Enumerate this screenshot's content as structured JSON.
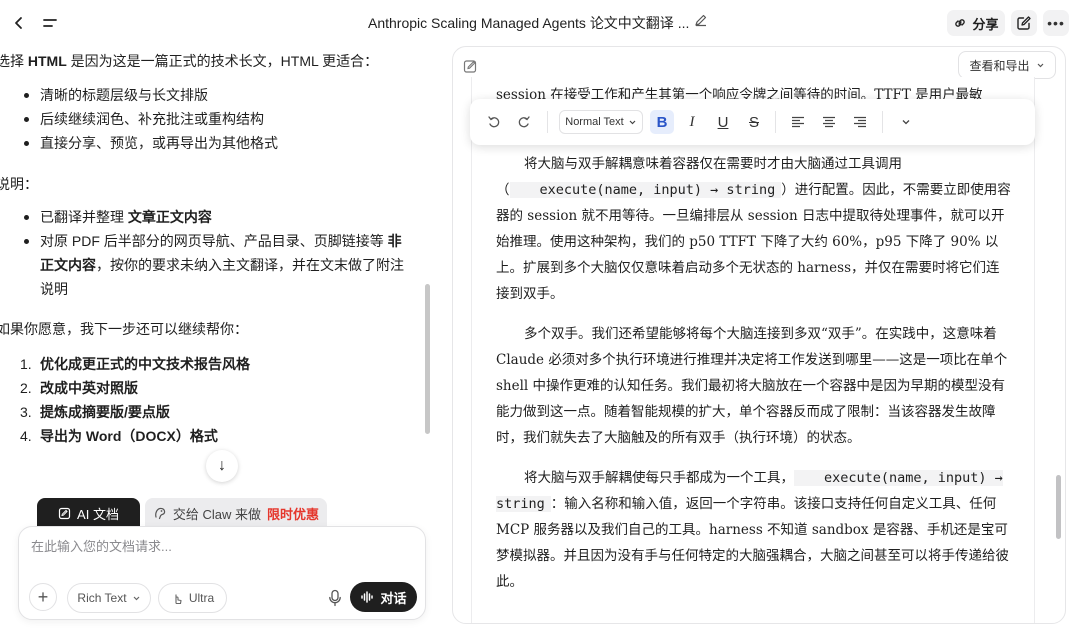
{
  "header": {
    "title": "Anthropic Scaling Managed Agents 论文中文翻译 ...",
    "share_label": "分享",
    "back_icon": "chevron-left-icon",
    "menu_icon": "menu-icon"
  },
  "chat": {
    "intro": [
      "选择 ",
      "HTML",
      " 是因为这是一篇正式的技术长文，HTML 更适合："
    ],
    "reasons": [
      "清晰的标题层级与长文排版",
      "后续继续润色、补充批注或重构结构",
      "直接分享、预览，或再导出为其他格式"
    ],
    "notes_heading": "说明：",
    "notes": [
      {
        "pre": "已翻译并整理 ",
        "bold": "文章正文内容",
        "post": ""
      },
      {
        "pre": "对原 PDF 后半部分的网页导航、产品目录、页脚链接等 ",
        "bold": "非正文内容",
        "post": "，按你的要求未纳入主文翻译，并在文末做了附注说明"
      }
    ],
    "next_heading": "如果你愿意，我下一步还可以继续帮你：",
    "next_steps": [
      "优化成更正式的中文技术报告风格",
      "改成中英对照版",
      "提炼成摘要版/要点版",
      "导出为 Word（DOCX）格式"
    ]
  },
  "composer": {
    "tab_ai": "AI 文档",
    "tab_claw": "交给 Claw 来做",
    "tab_claw_promo": "限时优惠",
    "placeholder": "在此输入您的文档请求...",
    "mode_label": "Rich Text",
    "model_label": "Ultra",
    "talk_label": "对话"
  },
  "document": {
    "export_label": "查看和导出",
    "toolbar": {
      "style_value": "Normal Text"
    },
    "top_line": "session 在接受工作和产生其第一个响应令牌之间等待的时间。TTFT 是用户最敏",
    "p1_pre": "将大脑与双手解耦意味着容器仅在需要时才由大脑通过工具调用（",
    "p1_code": "execute(name, input) → string",
    "p1_post": "）进行配置。因此，不需要立即使用容器的 session 就不用等待。一旦编排层从 session 日志中提取待处理事件，就可以开始推理。使用这种架构，我们的 p50 TTFT 下降了大约 60%，p95 下降了 90% 以上。扩展到多个大脑仅仅意味着启动多个无状态的 harness，并仅在需要时将它们连接到双手。",
    "p2": "多个双手。我们还希望能够将每个大脑连接到多双“双手”。在实践中，这意味着 Claude 必须对多个执行环境进行推理并决定将工作发送到哪里——这是一项比在单个 shell 中操作更难的认知任务。我们最初将大脑放在一个容器中是因为早期的模型没有能力做到这一点。随着智能规模的扩大，单个容器反而成了限制：当该容器发生故障时，我们就失去了大脑触及的所有双手（执行环境）的状态。",
    "p3_pre": "将大脑与双手解耦使每只手都成为一个工具，",
    "p3_code": "execute(name, input) → string",
    "p3_post": "：输入名称和输入值，返回一个字符串。该接口支持任何自定义工具、任何 MCP 服务器以及我们自己的工具。harness 不知道 sandbox 是容器、手机还是宝可梦模拟器。并且因为没有手与任何特定的大脑强耦合，大脑之间甚至可以将手传递给彼此。"
  }
}
